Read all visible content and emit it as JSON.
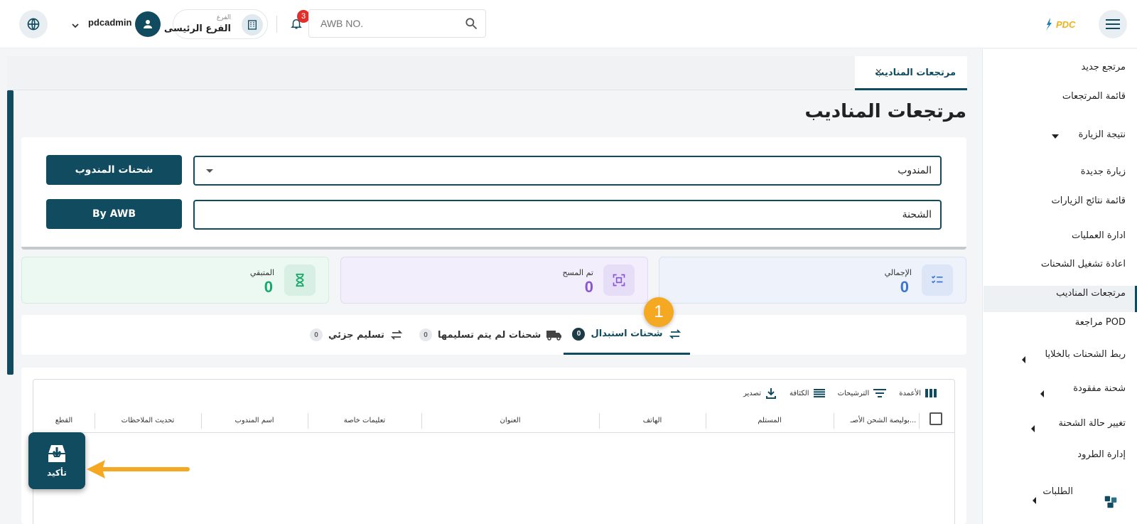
{
  "header": {
    "logo_text": "PDC",
    "search_placeholder": "AWB NO.",
    "notifications_count": "3",
    "branch_label": "الفرع",
    "branch_name": "الفرع الرئيسى",
    "username": "pdcadmin"
  },
  "sidebar": {
    "items": [
      {
        "label": "مرتجع جديد"
      },
      {
        "label": "قائمة المرتجعات"
      },
      {
        "label": "نتيجة الزيارة"
      },
      {
        "label": "زيارة جديدة"
      },
      {
        "label": "قائمة نتائج الزيارات"
      },
      {
        "label": "ادارة العمليات"
      },
      {
        "label": "اعادة تشغيل الشحنات"
      },
      {
        "label": "مرتجعات المناديب"
      },
      {
        "label": "مراجعة POD"
      },
      {
        "label": "ربط الشحنات بالخلايا"
      },
      {
        "label": "شحنة مفقودة"
      },
      {
        "label": "تغيير حالة الشحنة"
      },
      {
        "label": "إدارة الطرود"
      },
      {
        "label": "الطلبات"
      }
    ]
  },
  "tab": {
    "label": "مرتجعات المناديب",
    "close": "×"
  },
  "page": {
    "title": "مرتجعات المناديب"
  },
  "filters": {
    "courier_label": "المندوب",
    "shipment_label": "الشحنة",
    "courier_btn": "شحنات المندوب",
    "awb_btn": "By AWB"
  },
  "stats": {
    "total": {
      "label": "الإجمالي",
      "value": "0"
    },
    "scanned": {
      "label": "تم المسح",
      "value": "0"
    },
    "remaining": {
      "label": "المتبقي",
      "value": "0"
    }
  },
  "segments": [
    {
      "label": "شحنات استبدال",
      "count": "0"
    },
    {
      "label": "شحنات لم يتم تسليمها",
      "count": "0"
    },
    {
      "label": "تسليم جزئي",
      "count": "0"
    }
  ],
  "step_number": "1",
  "toolbar": {
    "columns": "الأعمدة",
    "filters": "الترشيحات",
    "density": "الكثافة",
    "export": "تصدير"
  },
  "table": {
    "headers": [
      "بوليصة الشحن الأصـ...",
      "المستلم",
      "الهاتف",
      "العنوان",
      "تعليمات خاصة",
      "اسم المندوب",
      "تحديث الملاحظات",
      "القطع"
    ]
  },
  "confirm": {
    "label": "تأكيد"
  },
  "colors": {
    "primary": "#114b5f",
    "accent": "#f5a822",
    "badge_red": "#e0302b"
  }
}
